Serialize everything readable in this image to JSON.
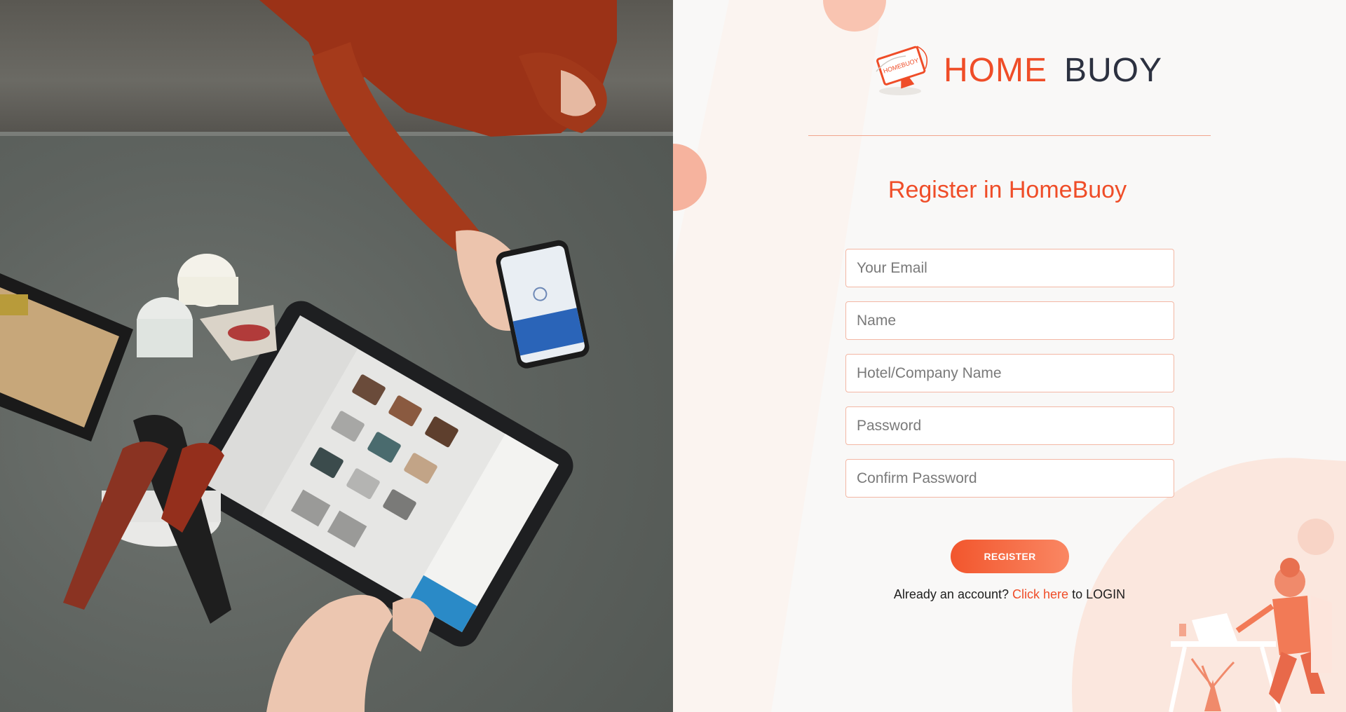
{
  "logo": {
    "word_home": "HOME",
    "word_buoy": "BUOY",
    "icon": "computer-monitor-logo-icon",
    "home_color": "#ef4d28",
    "buoy_color": "#2c3140"
  },
  "form": {
    "title": "Register in HomeBuoy",
    "fields": {
      "email_placeholder": "Your Email",
      "name_placeholder": "Name",
      "company_placeholder": "Hotel/Company Name",
      "password_placeholder": "Password",
      "confirm_password_placeholder": "Confirm Password"
    },
    "register_label": "REGISTER",
    "login_prompt": "Already an account?",
    "login_link": "Click here",
    "login_suffix": "to LOGIN"
  },
  "colors": {
    "accent": "#ef4d28",
    "button_gradient_start": "#f2562d",
    "button_gradient_end": "#fa8763",
    "field_border": "#f3b7a4",
    "background": "#f9f8f7"
  },
  "illustration": {
    "icon": "person-at-desk-with-laptop-illustration"
  },
  "photo": {
    "icon": "tablet-pos-checkout-photo"
  }
}
